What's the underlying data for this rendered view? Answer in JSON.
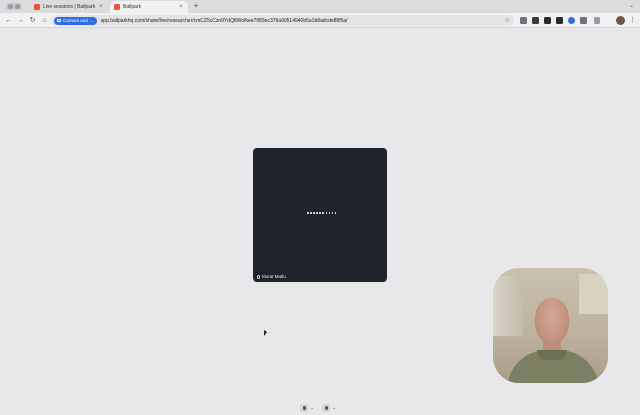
{
  "tabs": [
    {
      "title": "Live sessions | Ballpark",
      "close": "×"
    },
    {
      "title": "Ballpark",
      "close": "×"
    }
  ],
  "new_tab_symbol": "+",
  "tab_menu_symbol": "⌄",
  "nav": {
    "back": "←",
    "forward": "→",
    "reload": "↻",
    "home": "⌂"
  },
  "address_bar": {
    "chip_label": "Camera and …",
    "url": "app.ballparkhq.com/share/live/researcher/cmCZ5cCzn9YdQ8Wofkee7f/83ec376a90514940b5a1b8adcde88f5a/"
  },
  "bookmark_symbol": "☆",
  "menu_symbol": "⋮",
  "extension_colors": [
    "#6b7280",
    "#3a3a3a",
    "#2b2b2b",
    "#2b2b2b",
    "#2f6de0",
    "#6b7280"
  ],
  "participant": {
    "name": "Murat Mutlu",
    "loading_dots": 10
  },
  "colors": {
    "accent": "#2f6de0",
    "favicon": "#e8553a",
    "tile": "#1f232c"
  }
}
